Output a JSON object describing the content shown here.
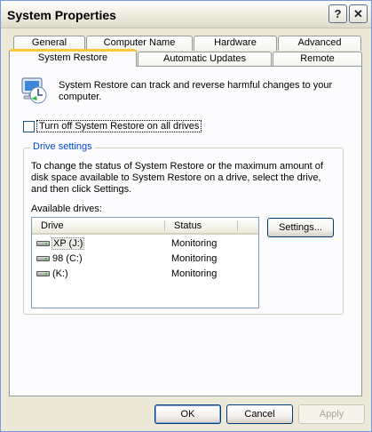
{
  "window": {
    "title": "System Properties",
    "help_label": "?",
    "close_label": "✕"
  },
  "tabs": {
    "row1": [
      "General",
      "Computer Name",
      "Hardware",
      "Advanced"
    ],
    "row2": [
      "System Restore",
      "Automatic Updates",
      "Remote"
    ],
    "active": "System Restore"
  },
  "intro": {
    "icon": "system-restore-icon",
    "text": "System Restore can track and reverse harmful changes to your computer."
  },
  "turn_off": {
    "checked": false,
    "label": "Turn off System Restore on all drives"
  },
  "drive_settings": {
    "title": "Drive settings",
    "description": "To change the status of System Restore or the maximum amount of disk space available to System Restore on a drive, select the drive, and then click Settings.",
    "available_label": "Available drives:",
    "columns": [
      "Drive",
      "Status"
    ],
    "drives": [
      {
        "icon": "hard-drive-icon",
        "name": "XP (J:)",
        "status": "Monitoring"
      },
      {
        "icon": "hard-drive-icon",
        "name": "98 (C:)",
        "status": "Monitoring"
      },
      {
        "icon": "hard-drive-icon",
        "name": " (K:)",
        "status": "Monitoring"
      }
    ],
    "settings_button": "Settings..."
  },
  "footer": {
    "ok": "OK",
    "cancel": "Cancel",
    "apply": "Apply"
  }
}
